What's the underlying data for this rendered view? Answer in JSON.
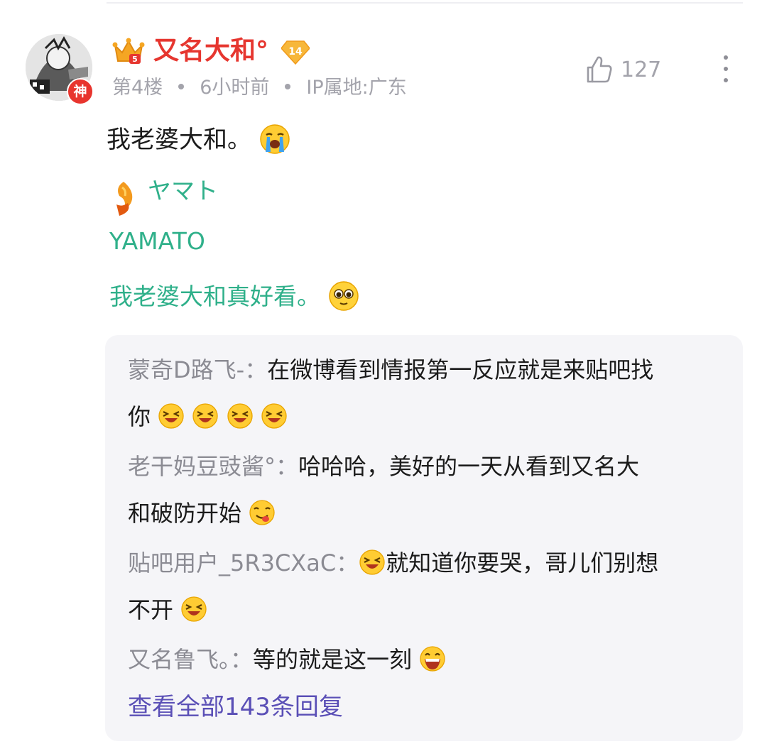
{
  "post": {
    "username": "又名大和°",
    "level": "14",
    "avatar_badge": "神",
    "floor": "第4楼",
    "time": "6小时前",
    "ip": "IP属地:广东",
    "likes": "127",
    "content": "我老婆大和。",
    "tag_jp": "ヤマト",
    "tag_en": "YAMATO",
    "green_text": "我老婆大和真好看。"
  },
  "replies": [
    {
      "author": "蒙奇D路飞-：",
      "line1": "在微博看到情报第一反应就是来贴吧找",
      "line2": "你"
    },
    {
      "author": "老干妈豆豉酱°：",
      "line1": "哈哈哈，美好的一天从看到又名大",
      "line2": "和破防开始"
    },
    {
      "author": "贴吧用户_5R3CXaC：",
      "line1": "就知道你要哭，哥儿们别想",
      "line2": "不开"
    },
    {
      "author": "又名鲁飞。：",
      "line1": "等的就是这一刻",
      "line2": ""
    }
  ],
  "view_all": "查看全部143条回复",
  "icons": {
    "crown": "crown-icon",
    "level": "diamond-level-icon",
    "like": "thumbs-up-icon",
    "more": "more-vertical-icon",
    "emoji_cry": "crying-emoji-icon",
    "emoji_adore": "adoring-emoji-icon",
    "emoji_laugh": "laughing-emoji-icon",
    "emoji_yum": "yum-emoji-icon",
    "emoji_grin": "grin-emoji-icon"
  },
  "colors": {
    "username": "#e6362f",
    "green": "#2fb08a",
    "link": "#5a4fb6",
    "meta": "#a3a3ab"
  }
}
